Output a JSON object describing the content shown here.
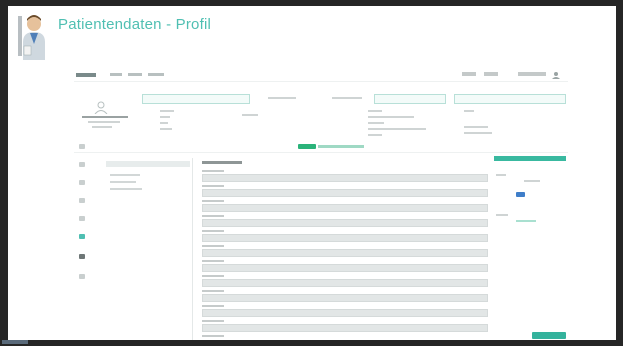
{
  "slide": {
    "title": "Patientendaten - Profil"
  },
  "colors": {
    "accent": "#4fbfb2",
    "save": "#33b29c",
    "active_tab": "#2bb37a",
    "toggle": "#3f7ec9"
  },
  "icons": {
    "avatar": "doctor-avatar-icon",
    "sidebar": [
      "home-icon",
      "calendar-icon",
      "patient-icon",
      "document-icon",
      "chart-icon",
      "settings-icon",
      "profile-icon",
      "help-icon"
    ]
  }
}
